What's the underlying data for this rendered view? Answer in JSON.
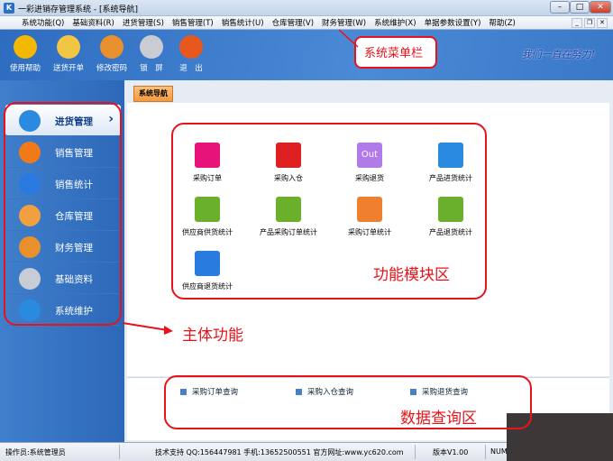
{
  "window": {
    "title": "一彩进销存管理系统 - [系统导航]",
    "app_icon": "K"
  },
  "menu": [
    "系统功能(Q)",
    "基础资料(R)",
    "进货管理(S)",
    "销售管理(T)",
    "销售统计(U)",
    "仓库管理(V)",
    "财务管理(W)",
    "系统维护(X)",
    "单据参数设置(Y)",
    "帮助(Z)"
  ],
  "toolbar": [
    {
      "label": "使用帮助",
      "icon": "lightbulb-icon",
      "color": "#f5b800"
    },
    {
      "label": "送货开单",
      "icon": "tag-icon",
      "color": "#f2c542"
    },
    {
      "label": "修改密码",
      "icon": "shield-icon",
      "color": "#e8902c"
    },
    {
      "label": "锁　屏",
      "icon": "lock-icon",
      "color": "#c9ccd2"
    },
    {
      "label": "退　出",
      "icon": "exit-icon",
      "color": "#e8581c"
    }
  ],
  "slogan": "我们一直在努力!",
  "sidebar": [
    {
      "label": "进货管理",
      "icon": "blocks-icon",
      "color": "#2a8ae0",
      "active": true
    },
    {
      "label": "销售管理",
      "icon": "rss-icon",
      "color": "#f07a18"
    },
    {
      "label": "销售统计",
      "icon": "pie-chart-icon",
      "color": "#2a7be0"
    },
    {
      "label": "仓库管理",
      "icon": "house-icon",
      "color": "#f0a040"
    },
    {
      "label": "财务管理",
      "icon": "shield-icon",
      "color": "#e8902c"
    },
    {
      "label": "基础资料",
      "icon": "database-icon",
      "color": "#c8ccd4"
    },
    {
      "label": "系统维护",
      "icon": "globe-icon",
      "color": "#2a8ae0"
    }
  ],
  "tab": "系统导航",
  "modules": [
    {
      "label": "采购订单",
      "icon": "order-icon",
      "color": "#e8137a"
    },
    {
      "label": "采购入仓",
      "icon": "basket-icon",
      "color": "#e02020"
    },
    {
      "label": "采购退货",
      "icon": "out-icon",
      "color": "#b07ae8",
      "text": "Out"
    },
    {
      "label": "产品进货统计",
      "icon": "bar-chart-icon",
      "color": "#2a8ae0"
    },
    {
      "label": "供应商供货统计",
      "icon": "report-icon",
      "color": "#6ab02c"
    },
    {
      "label": "产品采购订单统计",
      "icon": "report-icon",
      "color": "#6ab02c"
    },
    {
      "label": "采购订单统计",
      "icon": "line-chart-icon",
      "color": "#f08030"
    },
    {
      "label": "产品退货统计",
      "icon": "report-icon",
      "color": "#6ab02c"
    },
    {
      "label": "供应商退货统计",
      "icon": "pie-chart-icon",
      "color": "#2a7be0"
    }
  ],
  "queries": [
    "采购订单查询",
    "采购入仓查询",
    "采购退货查询"
  ],
  "status": {
    "operator": "操作员:系统管理员",
    "support": "技术支持 QQ:156447981 手机:13652500551 官方网址:www.yc620.com",
    "version": "版本V1.00",
    "num": "NUM"
  },
  "annotations": {
    "menu": "系统菜单栏",
    "modules": "功能模块区",
    "main": "主体功能",
    "query": "数据查询区",
    "color": "#e8131a"
  }
}
